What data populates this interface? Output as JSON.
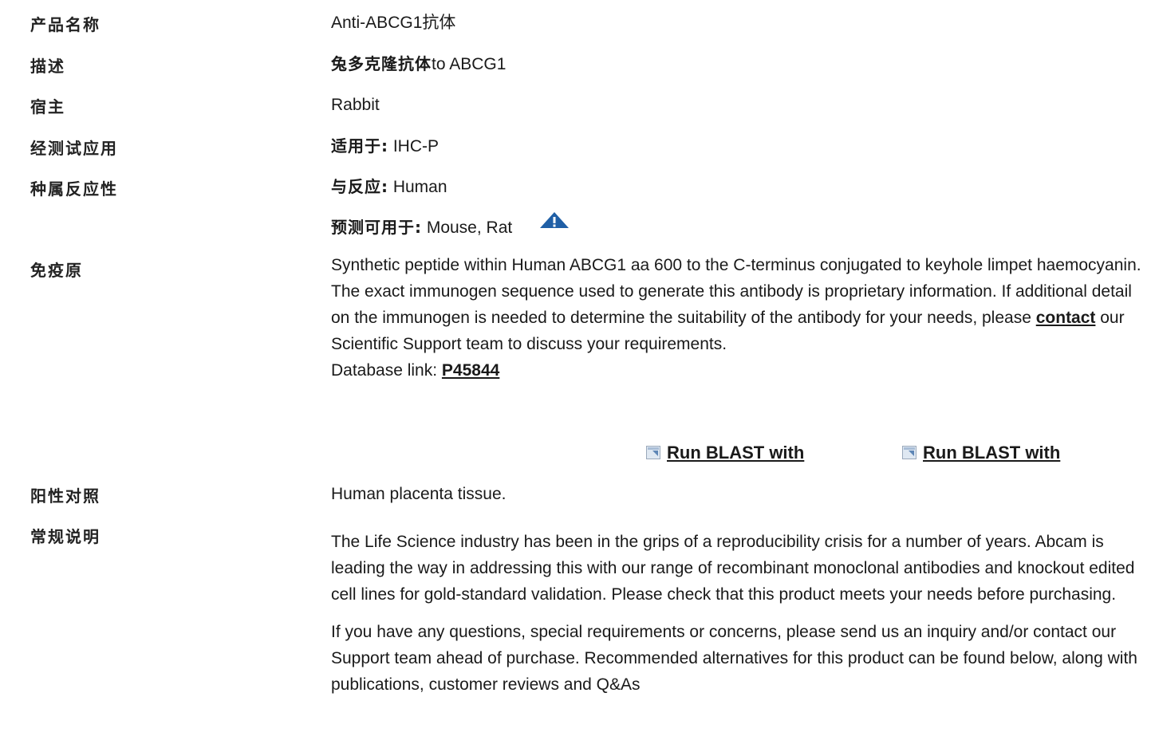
{
  "rows": {
    "product_name": {
      "label": "产品名称",
      "value": "Anti-ABCG1抗体"
    },
    "description": {
      "label": "描述",
      "value_bold": "兔多克隆抗体",
      "value_rest": "to ABCG1"
    },
    "host": {
      "label": "宿主",
      "value": "Rabbit"
    },
    "tested_applications": {
      "label": "经测试应用",
      "prefix": "适用于:",
      "value": " IHC-P"
    },
    "species_reactivity": {
      "label": "种属反应性",
      "prefix": "与反应:",
      "value": " Human",
      "predicted_prefix": "预测可用于:",
      "predicted_value": " Mouse, Rat"
    },
    "immunogen": {
      "label": "免疫原",
      "text_before_link": "Synthetic peptide within Human ABCG1 aa 600 to the C-terminus conjugated to keyhole limpet haemocyanin. The exact immunogen sequence used to generate this antibody is proprietary information. If additional detail on the immunogen is needed to determine the suitability of the antibody for your needs, please ",
      "link_text": "contact",
      "text_after_link": " our Scientific Support team to discuss your requirements.",
      "db_label": "Database link: ",
      "db_link": "P45844",
      "blast_1": "Run BLAST with",
      "blast_2": "Run BLAST with"
    },
    "positive_control": {
      "label": "阳性对照",
      "value": "Human placenta tissue."
    },
    "general_notes": {
      "label": "常规说明",
      "para1": "The Life Science industry has been in the grips of a reproducibility crisis for a number of years. Abcam is leading the way in addressing this with our range of recombinant monoclonal antibodies and knockout edited cell lines for gold-standard validation. Please check that this product meets your needs before purchasing.",
      "para2": "If you have any questions, special requirements or concerns, please send us an inquiry and/or contact our Support team ahead of purchase. Recommended alternatives for this product can be found below, along with publications, customer reviews and Q&As"
    }
  },
  "icons": {
    "warning": "warning-triangle-icon",
    "blast": "external-link-icon"
  },
  "colors": {
    "warning_blue": "#1f5fa6",
    "text": "#1a1a1a"
  }
}
